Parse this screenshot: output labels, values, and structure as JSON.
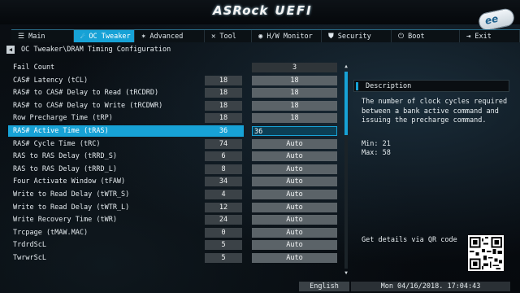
{
  "brand": {
    "asrock": "ASRock",
    "uefi": "UEFI"
  },
  "tabs": [
    {
      "label": "Main",
      "icon": "list-icon",
      "glyph": "☰"
    },
    {
      "label": "OC Tweaker",
      "icon": "rocket-icon",
      "glyph": "☄"
    },
    {
      "label": "Advanced",
      "icon": "star-icon",
      "glyph": "✶"
    },
    {
      "label": "Tool",
      "icon": "tools-icon",
      "glyph": "✕"
    },
    {
      "label": "H/W Monitor",
      "icon": "monitor-icon",
      "glyph": "◉"
    },
    {
      "label": "Security",
      "icon": "shield-icon",
      "glyph": "⛊"
    },
    {
      "label": "Boot",
      "icon": "power-icon",
      "glyph": "⏻"
    },
    {
      "label": "Exit",
      "icon": "exit-icon",
      "glyph": "⇥"
    }
  ],
  "active_tab": 1,
  "breadcrumb": "OC Tweaker\\DRAM Timing Configuration",
  "rows": [
    {
      "label": "Fail Count",
      "current": "",
      "value": "3"
    },
    {
      "label": "CAS# Latency (tCL)",
      "current": "18",
      "value": "18"
    },
    {
      "label": "RAS# to CAS# Delay to Read  (tRCDRD)",
      "current": "18",
      "value": "18"
    },
    {
      "label": "RAS# to CAS# Delay to Write (tRCDWR)",
      "current": "18",
      "value": "18"
    },
    {
      "label": "Row Precharge Time (tRP)",
      "current": "18",
      "value": "18"
    },
    {
      "label": "RAS# Active Time (tRAS)",
      "current": "36",
      "value": "36"
    },
    {
      "label": "RAS# Cycle Time (tRC)",
      "current": "74",
      "value": "Auto"
    },
    {
      "label": "RAS to RAS Delay (tRRD_S)",
      "current": "6",
      "value": "Auto"
    },
    {
      "label": "RAS to RAS Delay (tRRD_L)",
      "current": "8",
      "value": "Auto"
    },
    {
      "label": "Four Activate Window (tFAW)",
      "current": "34",
      "value": "Auto"
    },
    {
      "label": "Write to Read Delay (tWTR_S)",
      "current": "4",
      "value": "Auto"
    },
    {
      "label": "Write to Read Delay (tWTR_L)",
      "current": "12",
      "value": "Auto"
    },
    {
      "label": "Write Recovery Time (tWR)",
      "current": "24",
      "value": "Auto"
    },
    {
      "label": "Trcpage (tMAW.MAC)",
      "current": "0",
      "value": "Auto"
    },
    {
      "label": "TrdrdScL",
      "current": "5",
      "value": "Auto"
    },
    {
      "label": "TwrwrScL",
      "current": "5",
      "value": "Auto"
    }
  ],
  "selected_row": 5,
  "description": {
    "title": "Description",
    "body": "The number of clock cycles required between a bank active command and issuing the precharge command.",
    "min": "Min: 21",
    "max": "Max: 58",
    "qr_text": "Get details via QR code"
  },
  "footer": {
    "language": "English",
    "datetime": "Mon 04/16/2018. 17:04:43"
  },
  "colors": {
    "accent": "#17a2d6",
    "value_box": "#5b6368",
    "current_box": "#3b4247"
  }
}
